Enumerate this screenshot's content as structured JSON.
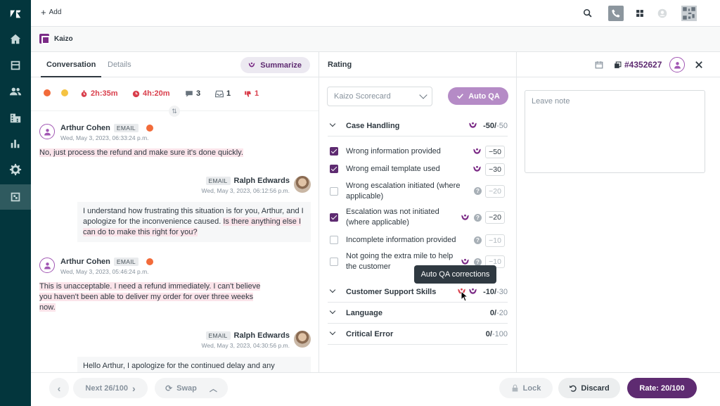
{
  "topbar": {
    "add_label": "Add"
  },
  "app": {
    "name": "Kaizo"
  },
  "tabs": {
    "conversation": "Conversation",
    "details": "Details"
  },
  "summarize_label": "Summarize",
  "stats": [
    {
      "value": "2h:35m",
      "color": "#d93f4c",
      "icon": "stopwatch-icon"
    },
    {
      "value": "4h:20m",
      "color": "#d93f4c",
      "icon": "clock-icon"
    },
    {
      "value": "3",
      "color": "#2f3941",
      "icon": "chat-bubble-icon"
    },
    {
      "value": "1",
      "color": "#2f3941",
      "icon": "inbox-icon"
    },
    {
      "value": "1",
      "color": "#d93f4c",
      "icon": "thumbs-down-icon"
    }
  ],
  "messages": [
    {
      "author": "Arthur Cohen",
      "channel": "EMAIL",
      "date": "Wed, May 3, 2023, 06:33:24 p.m.",
      "text": "No, just process the refund and make sure it's done quickly."
    },
    {
      "author": "Ralph Edwards",
      "channel": "EMAIL",
      "date": "Wed, May 3, 2023, 06:12:56 p.m.",
      "text_plain": "I understand how frustrating this situation is for you, Arthur, and I apologize for the inconvenience caused. ",
      "text_hl": "Is there anything else I can do to make this right for you?"
    },
    {
      "author": "Arthur Cohen",
      "channel": "EMAIL",
      "date": "Wed, May 3, 2023, 05:46:24 p.m.",
      "text": "This is unacceptable. I need a refund immediately. I can't believe you haven't been able to deliver my order for over three weeks now."
    },
    {
      "author": "Ralph Edwards",
      "channel": "EMAIL",
      "date": "Wed, May 3, 2023, 04:30:56 p.m.",
      "text": "Hello Arthur, I apologize for the continued delay and any"
    }
  ],
  "rating": {
    "title": "Rating",
    "scorecard_placeholder": "Kaizo Scorecard",
    "autoqa_label": "Auto QA",
    "ticket_id": "#4352627",
    "sections": [
      {
        "label": "Case Handling",
        "score": "-50/",
        "max": "-50"
      },
      {
        "label": "Customer Support Skills",
        "score": "-10/",
        "max": "-30"
      },
      {
        "label": "Language",
        "score": "0/",
        "max": "-20"
      },
      {
        "label": "Critical Error",
        "score": "0/",
        "max": "-100"
      }
    ],
    "criteria": [
      {
        "label": "Wrong information provided",
        "checked": true,
        "value": "−50"
      },
      {
        "label": "Wrong email template used",
        "checked": true,
        "value": "−30"
      },
      {
        "label": "Wrong escalation initiated (where applicable)",
        "checked": false,
        "value": "−20"
      },
      {
        "label": "Escalation was not initiated (where applicable)",
        "checked": true,
        "value": "−20"
      },
      {
        "label": "Incomplete information provided",
        "checked": false,
        "value": "−10"
      },
      {
        "label": "Not going the extra mile to help the customer",
        "checked": false,
        "value": "−10"
      }
    ],
    "tooltip": "Auto QA corrections"
  },
  "note_placeholder": "Leave note",
  "bottom": {
    "next_label": "Next 26/100",
    "swap_label": "Swap",
    "lock_label": "Lock",
    "discard_label": "Discard",
    "rate_label": "Rate: 20/100"
  },
  "colors": {
    "brand": "#5e2b71",
    "accent": "#a156b3",
    "danger": "#d93f4c",
    "rail": "#03363d"
  }
}
